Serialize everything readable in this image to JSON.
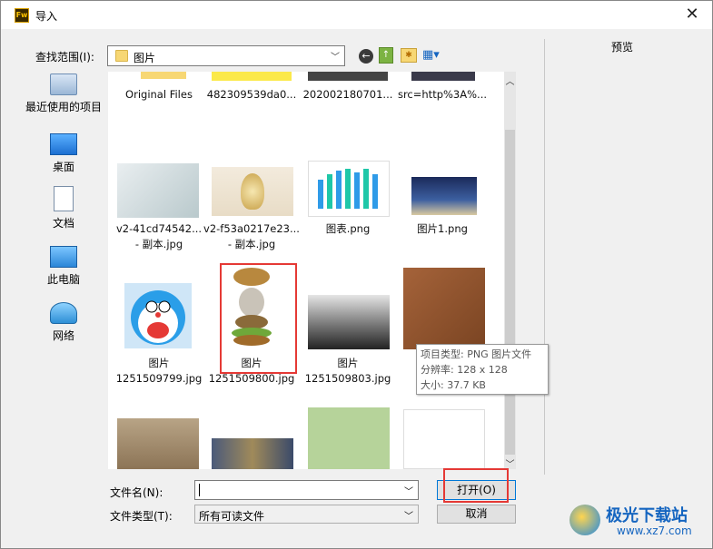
{
  "window": {
    "title": "导入",
    "close_glyph": "✕",
    "app_icon_text": "Fw"
  },
  "toolbar": {
    "lookin_label": "查找范围(I):",
    "lookin_value": "图片",
    "nav_back_glyph": "←",
    "nav_up_glyph": "↑",
    "nav_newfolder_glyph": "✱",
    "nav_view_glyph": "▦▾"
  },
  "places": [
    {
      "label": "最近使用的项目",
      "icon": "recent-items-icon"
    },
    {
      "label": "桌面",
      "icon": "desktop-icon"
    },
    {
      "label": "文档",
      "icon": "documents-icon"
    },
    {
      "label": "此电脑",
      "icon": "this-pc-icon"
    },
    {
      "label": "网络",
      "icon": "network-icon"
    }
  ],
  "files": [
    {
      "line1": "Original Files",
      "line2": ""
    },
    {
      "line1": "482309539da0...",
      "line2": ""
    },
    {
      "line1": "202002180701...",
      "line2": ""
    },
    {
      "line1": "src=http%3A%...",
      "line2": ""
    },
    {
      "line1": "v2-41cd74542...",
      "line2": "- 副本.jpg"
    },
    {
      "line1": "v2-f53a0217e23...",
      "line2": "- 副本.jpg"
    },
    {
      "line1": "图表.png",
      "line2": ""
    },
    {
      "line1": "图片1.png",
      "line2": ""
    },
    {
      "line1": "图片",
      "line2": "1251509799.jpg"
    },
    {
      "line1": "图片",
      "line2": "1251509800.jpg"
    },
    {
      "line1": "图片",
      "line2": "1251509803.jpg"
    },
    {
      "line1": "",
      "line2": ""
    }
  ],
  "tooltip": {
    "line1": "项目类型: PNG 图片文件",
    "line2": "分辨率: 128 x 128",
    "line3": "大小: 37.7 KB"
  },
  "preview": {
    "label": "预览"
  },
  "bottom": {
    "filename_label": "文件名(N):",
    "filename_value": "",
    "filetype_label": "文件类型(T):",
    "filetype_value": "所有可读文件",
    "open_label": "打开(O)",
    "cancel_label": "取消",
    "dropdown_glyph": "﹀"
  },
  "scroll": {
    "up_glyph": "︿",
    "down_glyph": "﹀"
  },
  "watermark": {
    "title": "极光下载站",
    "url": "www.xz7.com"
  },
  "colors": {
    "highlight": "#e53935",
    "accent": "#0078d7",
    "watermark": "#1565c0"
  }
}
